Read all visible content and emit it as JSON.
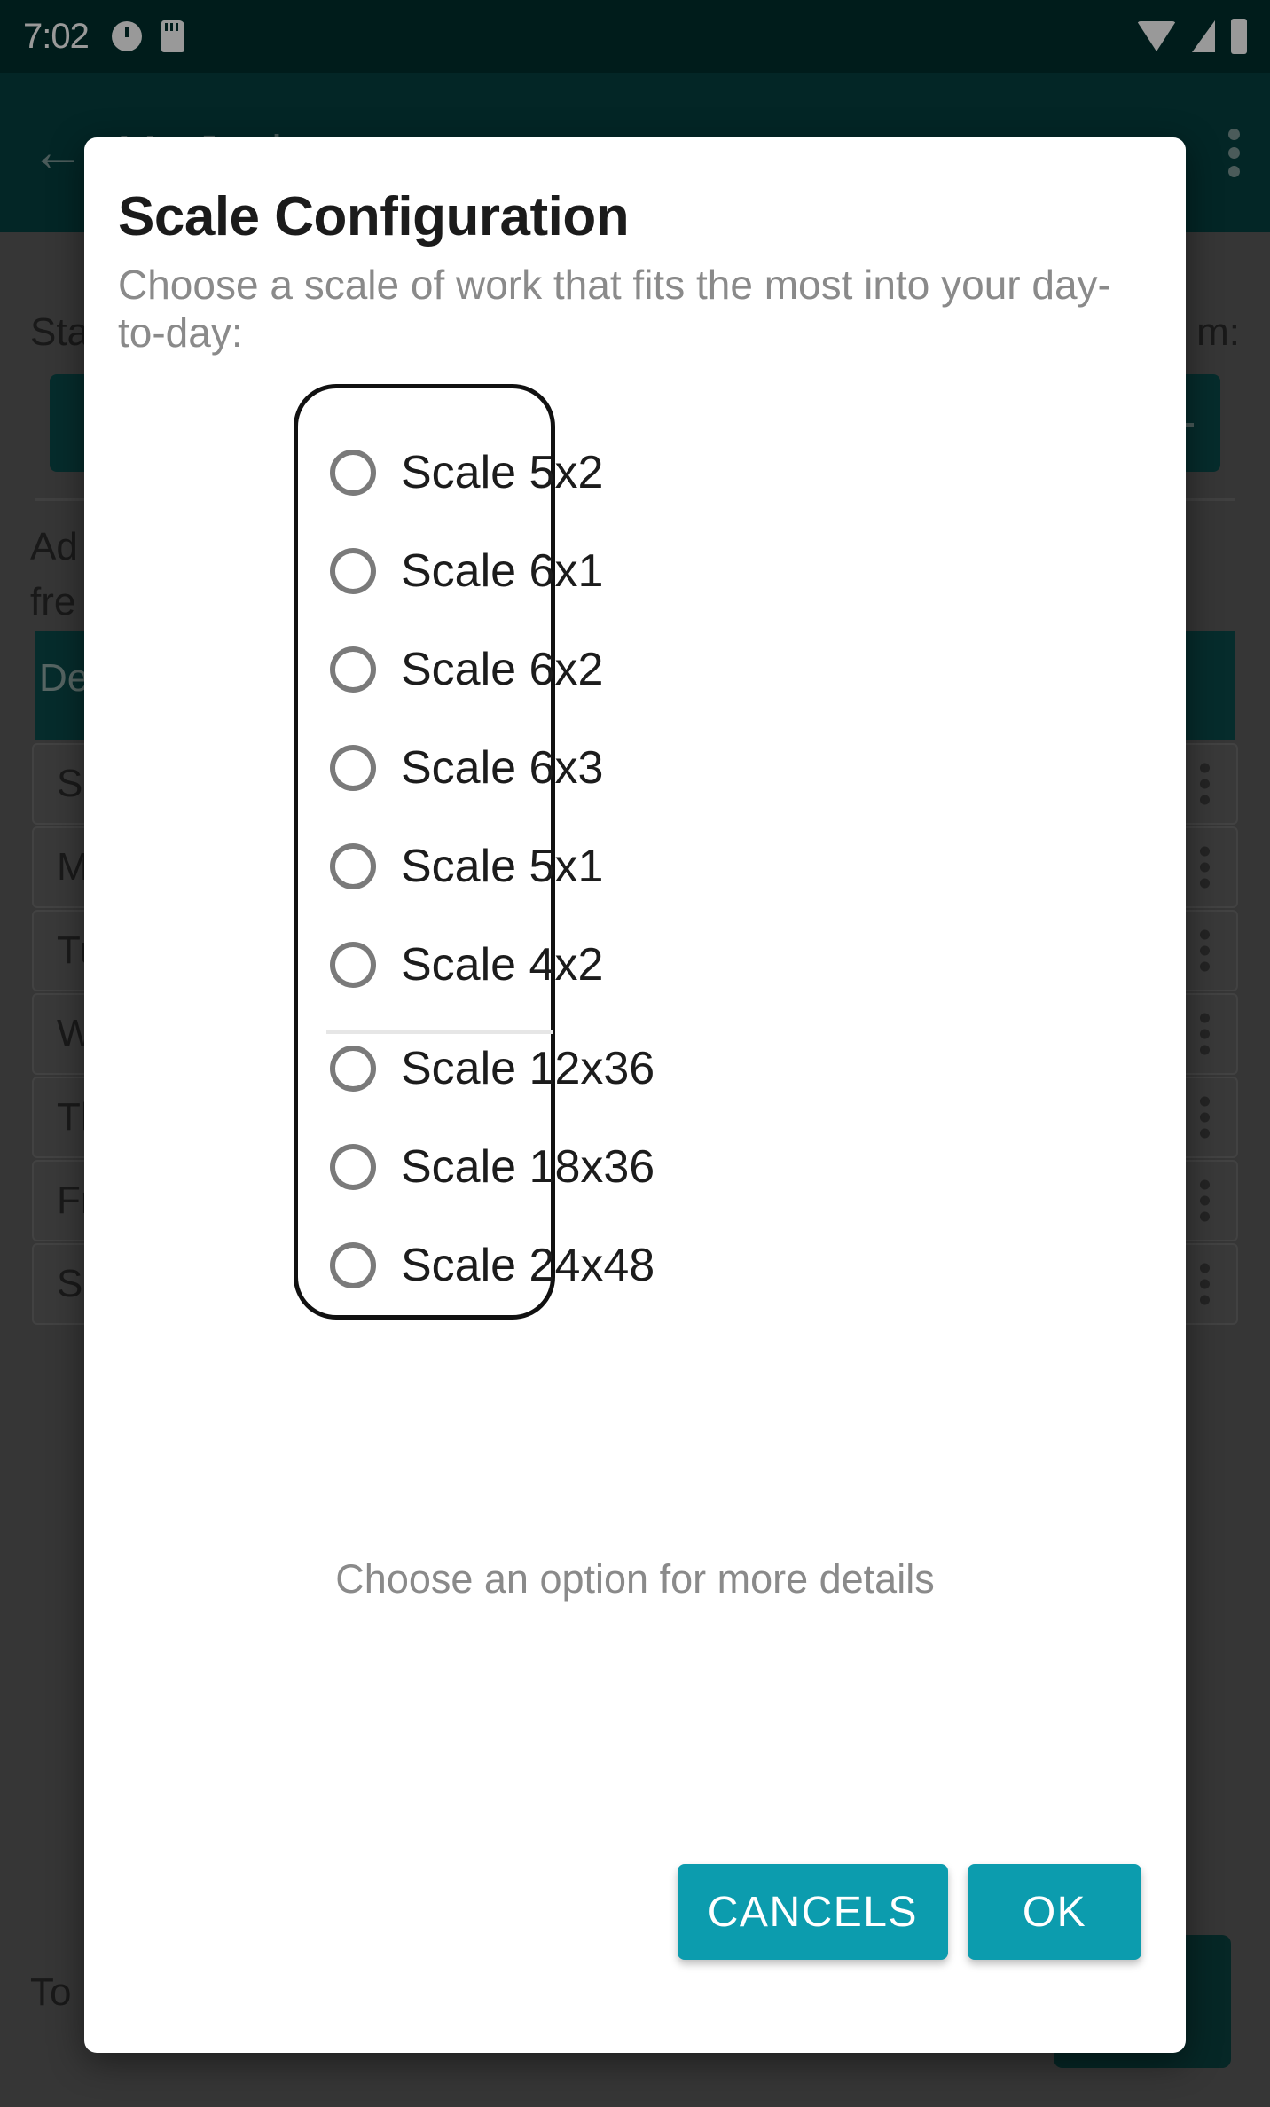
{
  "status_bar": {
    "clock": "7:02",
    "icons": [
      "alarm-icon",
      "sd-card-icon",
      "wifi-icon",
      "signal-icon",
      "battery-icon"
    ]
  },
  "app_bar": {
    "back_glyph": "←",
    "title": "My Joab",
    "overflow": "more-options-icon"
  },
  "background": {
    "labels": {
      "start_row": "Sta",
      "start_row_right": "m:",
      "add_row_line1": "Ad",
      "add_row_line2": "fre",
      "default_chip": "De",
      "total": "To"
    },
    "days": [
      "Su",
      "M",
      "Tu",
      "W",
      "Th",
      "Fr",
      "Sa"
    ]
  },
  "dialog": {
    "title": "Scale Configuration",
    "subtitle": "Choose a scale of work that fits the most into your day-to-day:",
    "options": [
      {
        "label": "Scale 5x2",
        "selected": false
      },
      {
        "label": "Scale 6x1",
        "selected": false
      },
      {
        "label": "Scale 6x2",
        "selected": false
      },
      {
        "label": "Scale 6x3",
        "selected": false
      },
      {
        "label": "Scale 5x1",
        "selected": false
      },
      {
        "label": "Scale 4x2",
        "selected": false
      },
      {
        "label": "Scale 12x36",
        "selected": false
      },
      {
        "label": "Scale 18x36",
        "selected": false
      },
      {
        "label": "Scale 24x48",
        "selected": false
      }
    ],
    "divider_after_index": 5,
    "hint": "Choose an option for more details",
    "buttons": {
      "cancel": "CANCELS",
      "ok": "OK"
    }
  },
  "colors": {
    "status_bar": "#00302E",
    "app_bar": "#054040",
    "accent_button": "#0C9CAE",
    "scrim": "rgba(0,0,0,0.40)",
    "radio_outline": "#7a7a7a",
    "list_border": "#111111"
  }
}
